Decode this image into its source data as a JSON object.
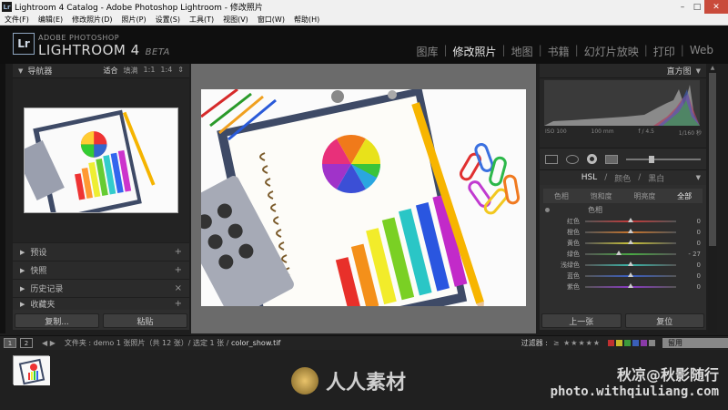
{
  "window": {
    "title": "Lightroom 4 Catalog - Adobe Photoshop Lightroom - 修改照片",
    "app_icon": "Lr",
    "min": "–",
    "max": "□",
    "close": "✕"
  },
  "menu": [
    "文件(F)",
    "编辑(E)",
    "修改照片(D)",
    "照片(P)",
    "设置(S)",
    "工具(T)",
    "视图(V)",
    "窗口(W)",
    "帮助(H)"
  ],
  "brand": {
    "logo": "Lr",
    "top": "ADOBE PHOTOSHOP",
    "main": "LIGHTROOM 4",
    "beta": "BETA"
  },
  "modules": [
    "图库",
    "修改照片",
    "地图",
    "书籍",
    "幻灯片放映",
    "打印",
    "Web"
  ],
  "left": {
    "navigator": {
      "title": "导航器",
      "zoom": [
        "适合",
        "填满",
        "1:1",
        "1:4"
      ],
      "menu_icon": "⇕"
    },
    "sections": [
      {
        "label": "预设",
        "action": "+"
      },
      {
        "label": "快照",
        "action": "+"
      },
      {
        "label": "历史记录",
        "action": "×"
      },
      {
        "label": "收藏夹",
        "action": "+"
      }
    ],
    "buttons": {
      "copy": "复制...",
      "paste": "粘贴"
    }
  },
  "right": {
    "histogram": {
      "title": "直方图",
      "info": [
        "ISO 100",
        "100 mm",
        "f / 4.5",
        "1/160 秒"
      ]
    },
    "hsl": {
      "tabs_header": [
        "HSL",
        "颜色",
        "黑白"
      ],
      "sub_tabs": [
        "色相",
        "饱和度",
        "明亮度",
        "全部"
      ],
      "group": "色相",
      "sliders": [
        {
          "label": "红色",
          "value": "0",
          "pos": 0.5,
          "color": "#c43a3a"
        },
        {
          "label": "橙色",
          "value": "0",
          "pos": 0.5,
          "color": "#c7742c"
        },
        {
          "label": "黄色",
          "value": "0",
          "pos": 0.5,
          "color": "#c9c23a"
        },
        {
          "label": "绿色",
          "value": "- 27",
          "pos": 0.365,
          "color": "#4aa844"
        },
        {
          "label": "浅绿色",
          "value": "0",
          "pos": 0.5,
          "color": "#3bb5a8"
        },
        {
          "label": "蓝色",
          "value": "0",
          "pos": 0.5,
          "color": "#3a5fc4"
        },
        {
          "label": "紫色",
          "value": "0",
          "pos": 0.5,
          "color": "#8a3ac4"
        }
      ]
    },
    "buttons": {
      "prev": "上一张",
      "reset": "复位"
    }
  },
  "filmbar": {
    "page1": "1",
    "page2": "2",
    "nav": "◀ ▶",
    "path_prefix": "文件夹 : demo",
    "counts": "1 张照片（共 12 张）/ 选定 1 张 /",
    "filename": "color_show.tif",
    "filter_label": "过滤器 :",
    "stars": "≥ ★★★★★",
    "filter_select": "留用",
    "label_colors": [
      "#c03030",
      "#c9b92a",
      "#3c9a3c",
      "#3a5fb8",
      "#8a3aa8",
      "#888888"
    ]
  },
  "watermark": {
    "center": "人人素材",
    "line1": "秋凉@秋影随行",
    "line2": "photo.withqiuliang.com"
  }
}
